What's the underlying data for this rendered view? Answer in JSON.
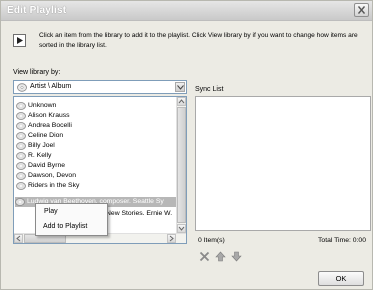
{
  "window": {
    "title": "Edit Playlist"
  },
  "instructions": "Click an item from the library to add it to the playlist. Click View library by if you want to change how items are sorted in the library list.",
  "view_by": {
    "label": "View library by:",
    "selected": "Artist \\ Album"
  },
  "library": {
    "items": [
      "Unknown",
      "Alison Krauss",
      "Andrea Bocelli",
      "Celine Dion",
      "Billy Joel",
      "R. Kelly",
      "David Byrne",
      "Dawson, Devon",
      "Riders in the Sky",
      "Ludwig van Beethoven, composer. Seattle Sy",
      "New Stories. Ernie W."
    ],
    "selected_index": 9
  },
  "context_menu": {
    "items": [
      "Play",
      "Add to Playlist"
    ]
  },
  "sync": {
    "label": "Sync List",
    "count": "0 Item(s)",
    "total": "Total Time: 0:00"
  },
  "actions": {
    "icons": [
      "delete-icon",
      "move-up-icon",
      "move-down-icon"
    ]
  },
  "ok_label": "OK",
  "colors": {
    "selection": "#b7b7b7",
    "list_border": "#7f9db9",
    "dialog_bg": "#ecebe4"
  }
}
